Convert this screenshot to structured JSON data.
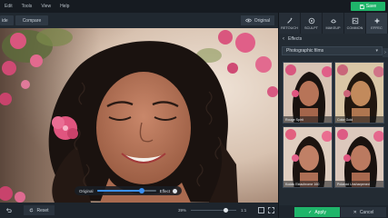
{
  "menu": {
    "items": [
      "Edit",
      "Tools",
      "View",
      "Help"
    ]
  },
  "save_button": {
    "label": "Save"
  },
  "toolbar": {
    "partial_label": "ide",
    "compare_label": "Compare",
    "original_label": "Original"
  },
  "effect_slider": {
    "left_label": "Original",
    "right_label": "Effect",
    "value_pct": 76
  },
  "bottom": {
    "reset_label": "Reset",
    "zoom_label": "39%",
    "zoom_ratio": "1:1"
  },
  "tabs": [
    {
      "label": "RETOUCH",
      "icon": "magic-wand-icon"
    },
    {
      "label": "SCULPT",
      "icon": "sculpt-icon"
    },
    {
      "label": "MAKEUP",
      "icon": "makeup-icon"
    },
    {
      "label": "COMMON",
      "icon": "common-icon"
    },
    {
      "label": "EFFEC",
      "icon": "effects-icon"
    }
  ],
  "effects_panel": {
    "breadcrumb": "Effects",
    "category": "Photographic films",
    "thumbnails": [
      {
        "caption": "Rouge Spirit"
      },
      {
        "caption": "Color Gold"
      },
      {
        "caption": "Kodak Ektachrome 160"
      },
      {
        "caption": "Polaroid Unsharpened"
      }
    ],
    "apply_label": "Apply",
    "cancel_label": "Cancel"
  },
  "colors": {
    "accent_green": "#1fb56a",
    "accent_blue": "#3b8ff0"
  }
}
